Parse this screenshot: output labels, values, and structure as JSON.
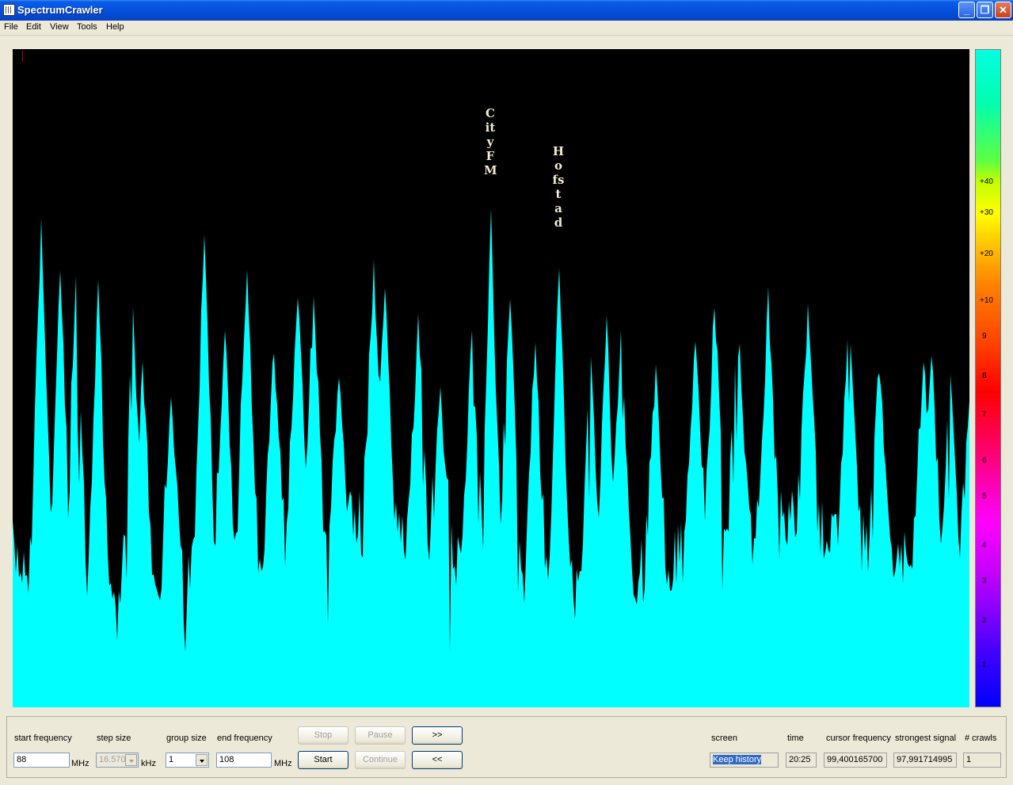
{
  "window": {
    "title": "SpectrumCrawler"
  },
  "menu": [
    "File",
    "Edit",
    "View",
    "Tools",
    "Help"
  ],
  "stations": [
    {
      "name": "City FM"
    },
    {
      "name": "Hofstad"
    }
  ],
  "scale_labels": [
    "+40",
    "+30",
    "+20",
    "+10",
    "9",
    "8",
    "7",
    "6",
    "5",
    "4",
    "3",
    "2",
    "1"
  ],
  "controls": {
    "start_frequency": {
      "label": "start frequency",
      "value": "88",
      "unit": "MHz"
    },
    "step_size": {
      "label": "step size",
      "value": "16.570",
      "unit": "kHz"
    },
    "group_size": {
      "label": "group size",
      "value": "1"
    },
    "end_frequency": {
      "label": "end frequency",
      "value": "108",
      "unit": "MHz"
    },
    "buttons": {
      "stop": "Stop",
      "pause": "Pause",
      "forward": ">>",
      "start": "Start",
      "continue": "Continue",
      "back": "<<"
    }
  },
  "status": {
    "screen": {
      "label": "screen",
      "value": "Keep history"
    },
    "time": {
      "label": "time",
      "value": "20:25"
    },
    "cursor_frequency": {
      "label": "cursor frequency",
      "value": "99,400165700"
    },
    "strongest_signal": {
      "label": "strongest signal",
      "value": "97,991714995"
    },
    "crawls": {
      "label": "# crawls",
      "value": "1"
    }
  },
  "colors": {
    "spectrum": "#00ffff",
    "background": "#000000"
  }
}
